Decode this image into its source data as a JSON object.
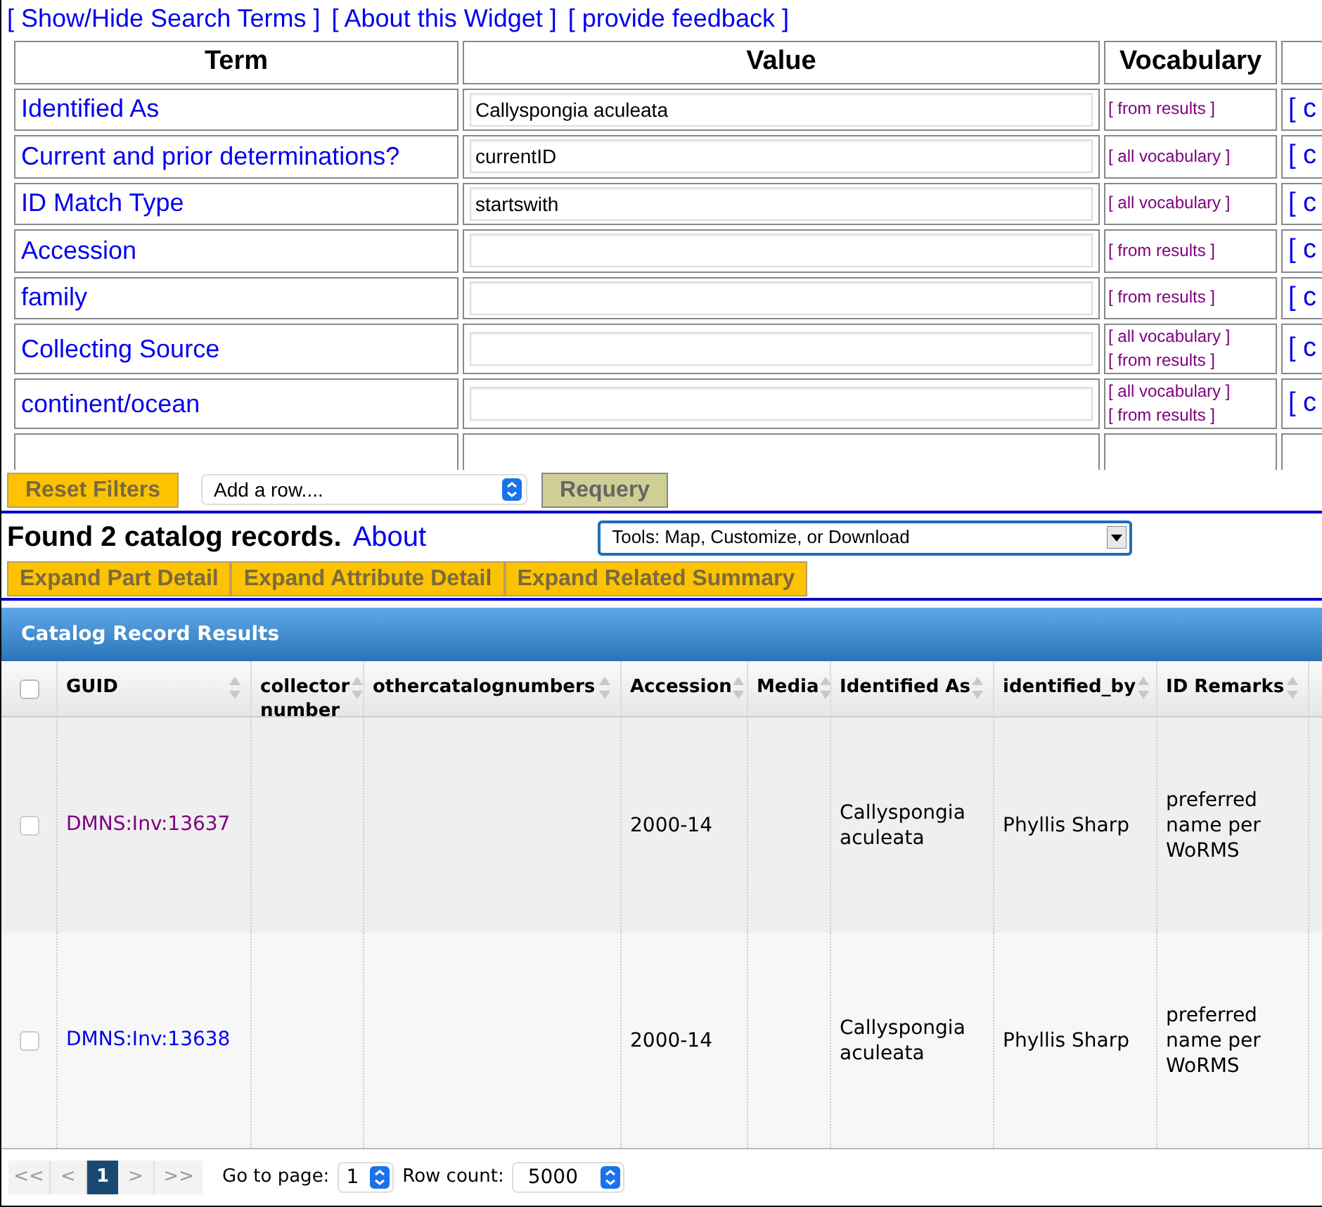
{
  "top_links": [
    "[ Show/Hide Search Terms ]",
    "[ About this Widget ]",
    "[ provide feedback ]"
  ],
  "search_table": {
    "columns": [
      "Term",
      "Value",
      "Vocabulary"
    ],
    "rows": [
      {
        "term": "Identified As",
        "value": "Callyspongia aculeata",
        "vocab": [
          "[ from results ]"
        ],
        "column_4": "[ c"
      },
      {
        "term": "Current and prior determinations?",
        "value": "currentID",
        "vocab": [
          "[ all vocabulary ]"
        ],
        "column_4": "[ c"
      },
      {
        "term": "ID Match Type",
        "value": "startswith",
        "vocab": [
          "[ all vocabulary ]"
        ],
        "column_4": "[ c"
      },
      {
        "term": "Accession",
        "value": "",
        "vocab": [
          "[ from results ]"
        ],
        "column_4": "[ c"
      },
      {
        "term": "family",
        "value": "",
        "vocab": [
          "[ from results ]"
        ],
        "column_4": "[ c"
      },
      {
        "term": "Collecting Source",
        "value": "",
        "vocab": [
          "[ all vocabulary ]",
          "[ from results ]"
        ],
        "column_4": "[ c"
      },
      {
        "term": "continent/ocean",
        "value": "",
        "vocab": [
          "[ all vocabulary ]",
          "[ from results ]"
        ],
        "column_4": "[ c"
      }
    ]
  },
  "reset_button": "Reset Filters",
  "add_row_select": "Add a row....",
  "requery_button": "Requery",
  "found_text": "Found 2 catalog records.",
  "about_link": "About",
  "tools_select": "Tools: Map, Customize, or Download",
  "expand_buttons": [
    "Expand Part Detail",
    "Expand Attribute Detail",
    "Expand Related Summary"
  ],
  "results": {
    "title": "Catalog Record Results",
    "select_all_checked": false,
    "columns": [
      "GUID",
      "collector number",
      "othercatalognumbers",
      "Accession",
      "Media",
      "Identified As",
      "identified_by",
      "ID Remarks"
    ],
    "rows": [
      {
        "checked": false,
        "visited": true,
        "guid": "DMNS:Inv:13637",
        "accession": "2000-14",
        "identified_as": "Callyspongia aculeata",
        "identified_by": "Phyllis Sharp",
        "id_remarks": "preferred name per WoRMS"
      },
      {
        "checked": false,
        "visited": false,
        "guid": "DMNS:Inv:13638",
        "accession": "2000-14",
        "identified_as": "Callyspongia aculeata",
        "identified_by": "Phyllis Sharp",
        "id_remarks": "preferred name per WoRMS"
      }
    ]
  },
  "pager": {
    "first": "<<",
    "prev": "<",
    "pages": [
      {
        "label": "1",
        "selected": true
      }
    ],
    "next": ">",
    "last": ">>",
    "goto_label": "Go to page:",
    "goto_value": "1",
    "rowcount_label": "Row count:",
    "rowcount_value": "5000"
  }
}
